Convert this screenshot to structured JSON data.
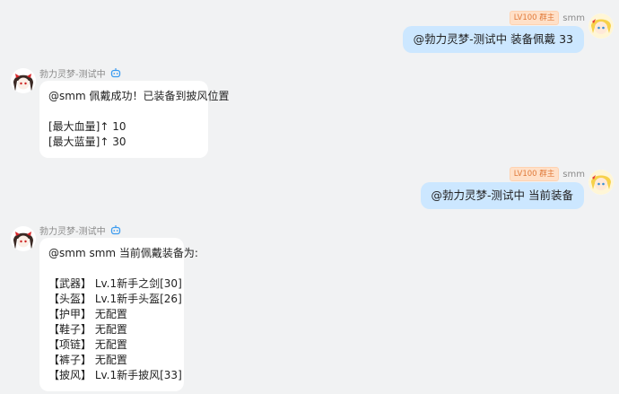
{
  "messages": [
    {
      "side": "right",
      "sender": "smm",
      "badge": "LV100 群主",
      "text": "@勃力灵梦-测试中 装备佩戴 33"
    },
    {
      "side": "left",
      "sender": "勃力灵梦-测试中",
      "lines": [
        "@smm 佩戴成功！已装备到披风位置",
        "",
        "[最大血量]↑ 10",
        "[最大蓝量]↑ 30"
      ]
    },
    {
      "side": "right",
      "sender": "smm",
      "badge": "LV100 群主",
      "text": "@勃力灵梦-测试中 当前装备"
    },
    {
      "side": "left",
      "sender": "勃力灵梦-测试中",
      "lines": [
        "@smm smm 当前佩戴装备为:",
        "",
        "【武器】 Lv.1新手之剑[30]",
        "【头盔】 Lv.1新手头盔[26]",
        "【护甲】 无配置",
        "【鞋子】 无配置",
        "【项链】 无配置",
        "【裤子】 无配置",
        "【披风】 Lv.1新手披风[33]"
      ]
    }
  ],
  "colors": {
    "background": "#f1f2f3",
    "user_bubble": "#cce7ff",
    "bot_bubble": "#ffffff",
    "badge_bg": "#ffe0c8",
    "badge_text": "#e07a3a",
    "bot_icon": "#3d9cf0"
  },
  "icons": {
    "user_avatar": "blonde-anime-avatar",
    "bot_avatar": "reimu-anime-avatar",
    "bot_badge": "robot-icon"
  }
}
